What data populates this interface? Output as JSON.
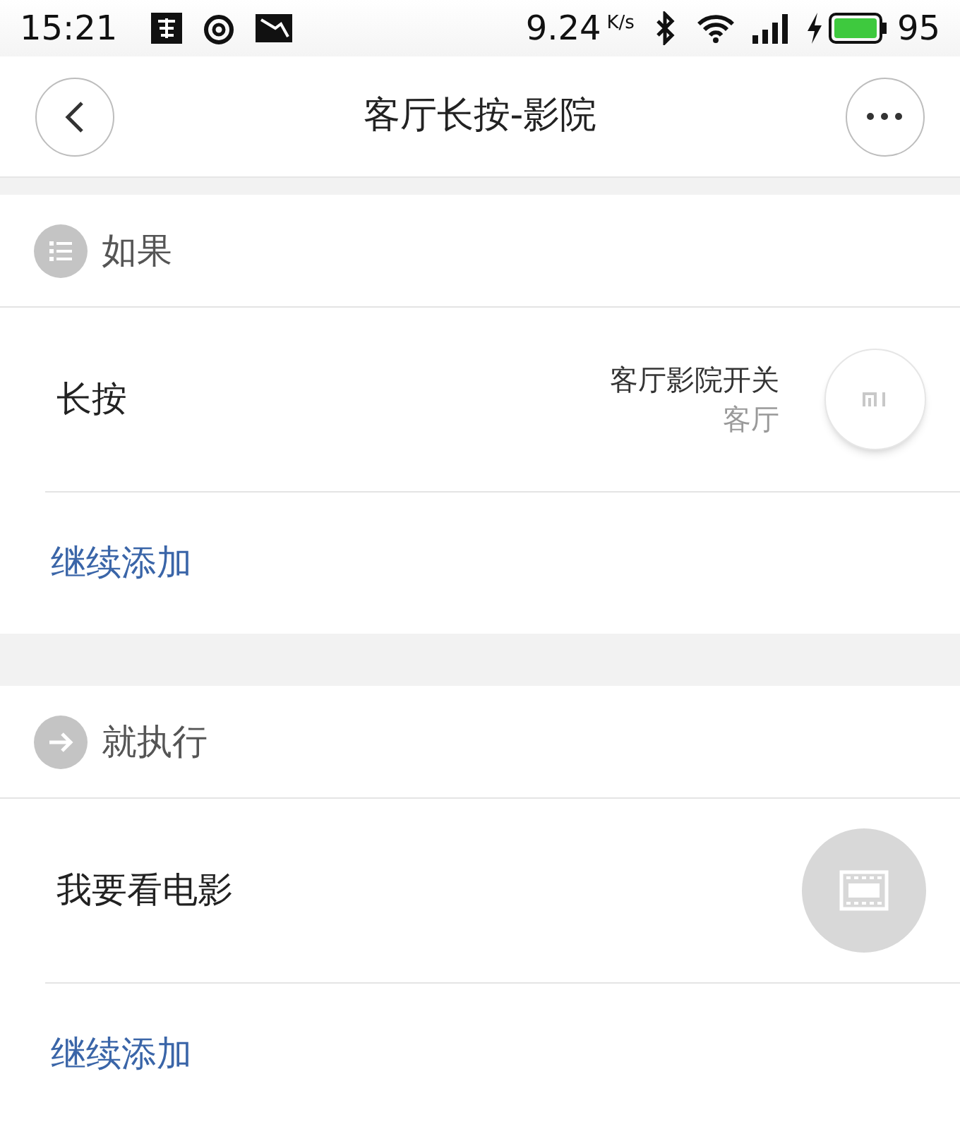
{
  "status_bar": {
    "time": "15:21",
    "speed": "9.24",
    "speed_unit": "K/s",
    "battery": "95"
  },
  "header": {
    "title": "客厅长按-影院"
  },
  "sections": [
    {
      "title": "如果",
      "kind": "condition",
      "items": [
        {
          "label": "长按",
          "device_name": "客厅影院开关",
          "room": "客厅",
          "kind": "switch"
        }
      ],
      "add_link": "继续添加"
    },
    {
      "title": "就执行",
      "kind": "action",
      "items": [
        {
          "label": "我要看电影",
          "kind": "scene"
        }
      ],
      "add_link": "继续添加"
    }
  ]
}
